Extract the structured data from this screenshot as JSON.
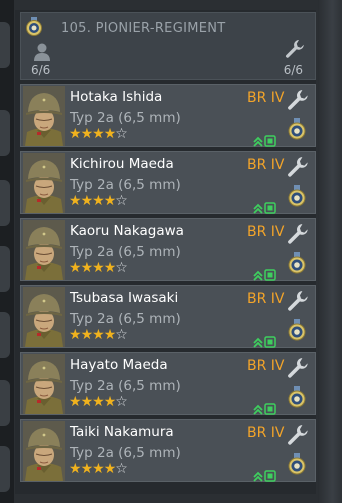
{
  "header": {
    "title": "105. PIONIER-REGIMENT",
    "crew_count": "6/6",
    "repair_count": "6/6"
  },
  "crew": [
    {
      "name": "Hotaka Ishida",
      "vehicle": "Typ 2a (6,5 mm)",
      "br": "BR IV",
      "stars": 4
    },
    {
      "name": "Kichirou Maeda",
      "vehicle": "Typ 2a (6,5 mm)",
      "br": "BR IV",
      "stars": 4
    },
    {
      "name": "Kaoru Nakagawa",
      "vehicle": "Typ 2a (6,5 mm)",
      "br": "BR IV",
      "stars": 4
    },
    {
      "name": "Tsubasa Iwasaki",
      "vehicle": "Typ 2a (6,5 mm)",
      "br": "BR IV",
      "stars": 4
    },
    {
      "name": "Hayato Maeda",
      "vehicle": "Typ 2a (6,5 mm)",
      "br": "BR IV",
      "stars": 4
    },
    {
      "name": "Taiki Nakamura",
      "vehicle": "Typ 2a (6,5 mm)",
      "br": "BR IV",
      "stars": 4
    }
  ],
  "max_stars": 5,
  "colors": {
    "br": "#f2a42a",
    "star_on": "#f0b21e",
    "rank_green": "#3ecf5e"
  }
}
